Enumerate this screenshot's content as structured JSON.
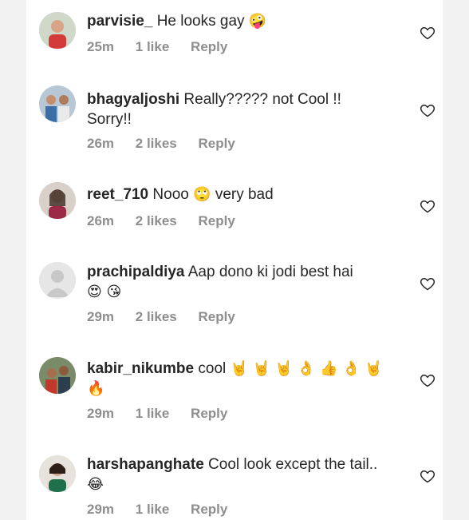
{
  "comments": [
    {
      "username": "parvisie_",
      "text": "He looks gay",
      "emojis": "🤪",
      "time": "25m",
      "likes": "1 like",
      "reply": "Reply"
    },
    {
      "username": "bhagyaljoshi",
      "text": "Really????? not Cool !! Sorry!!",
      "emojis": "",
      "time": "26m",
      "likes": "2 likes",
      "reply": "Reply"
    },
    {
      "username": "reet_710",
      "text": "Nooo",
      "emojis": "🙄",
      "text2": "very bad",
      "time": "26m",
      "likes": "2 likes",
      "reply": "Reply"
    },
    {
      "username": "prachipaldiya",
      "text": "Aap dono ki jodi best hai",
      "emojis": "😍 😘",
      "time": "29m",
      "likes": "2 likes",
      "reply": "Reply"
    },
    {
      "username": "kabir_nikumbe",
      "text": "cool",
      "emojis": "🤘 🤘 🤘 👌 👍 👌 🤘 🔥",
      "time": "29m",
      "likes": "1 like",
      "reply": "Reply"
    },
    {
      "username": "harshapanghate",
      "text": "Cool look except the tail..",
      "emojis": "😂",
      "time": "29m",
      "likes": "1 like",
      "reply": "Reply"
    }
  ],
  "icons": {
    "like": "heart-outline-icon"
  },
  "colors": {
    "meta": "#8e8e8e",
    "text": "#262626",
    "background": "#ffffff"
  }
}
